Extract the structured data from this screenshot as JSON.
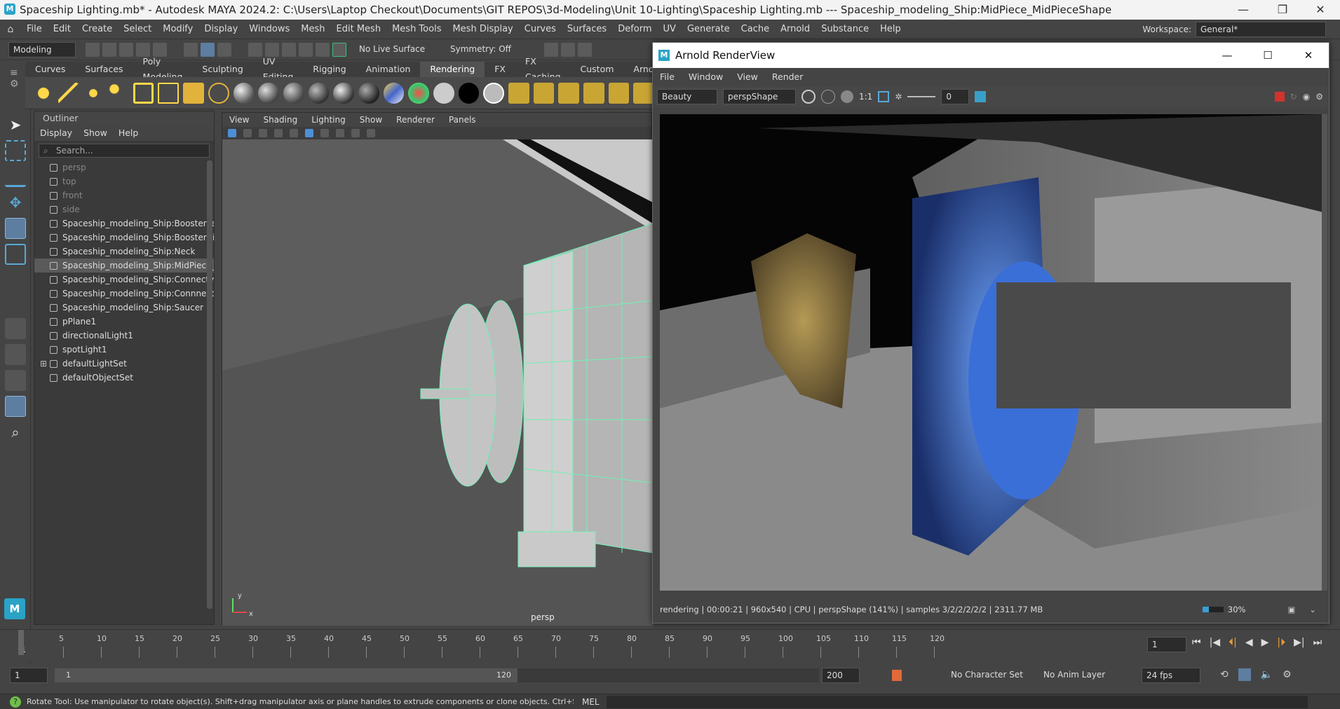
{
  "title_bar": {
    "title": "Spaceship Lighting.mb* - Autodesk MAYA 2024.2: C:\\Users\\Laptop Checkout\\Documents\\GIT REPOS\\3d-Modeling\\Unit 10-Lighting\\Spaceship Lighting.mb   ---   Spaceship_modeling_Ship:MidPiece_MidPieceShape"
  },
  "menu": [
    "File",
    "Edit",
    "Create",
    "Select",
    "Modify",
    "Display",
    "Windows",
    "Mesh",
    "Edit Mesh",
    "Mesh Tools",
    "Mesh Display",
    "Curves",
    "Surfaces",
    "Deform",
    "UV",
    "Generate",
    "Cache",
    "Arnold",
    "Substance",
    "Help"
  ],
  "workspace": {
    "label": "Workspace:",
    "value": "General*"
  },
  "status_line": {
    "mode": "Modeling",
    "live_surface": "No Live Surface",
    "symmetry": "Symmetry: Off"
  },
  "shelf_tabs": [
    "Curves",
    "Surfaces",
    "Poly Modeling",
    "Sculpting",
    "UV Editing",
    "Rigging",
    "Animation",
    "Rendering",
    "FX",
    "FX Caching",
    "Custom",
    "Arnold"
  ],
  "shelf_active": "Rendering",
  "outliner": {
    "title": "Outliner",
    "menu": [
      "Display",
      "Show",
      "Help"
    ],
    "search_placeholder": "Search...",
    "items": [
      {
        "label": "persp",
        "dim": true
      },
      {
        "label": "top",
        "dim": true
      },
      {
        "label": "front",
        "dim": true
      },
      {
        "label": "side",
        "dim": true
      },
      {
        "label": "Spaceship_modeling_Ship:BoosterLef"
      },
      {
        "label": "Spaceship_modeling_Ship:BoosterRig"
      },
      {
        "label": "Spaceship_modeling_Ship:Neck"
      },
      {
        "label": "Spaceship_modeling_Ship:MidPiece_I",
        "selected": true
      },
      {
        "label": "Spaceship_modeling_Ship:ConnectyL"
      },
      {
        "label": "Spaceship_modeling_Ship:Connnecty"
      },
      {
        "label": "Spaceship_modeling_Ship:Saucer"
      },
      {
        "label": "pPlane1"
      },
      {
        "label": "directionalLight1"
      },
      {
        "label": "spotLight1"
      },
      {
        "label": "defaultLightSet",
        "expandable": true
      },
      {
        "label": "defaultObjectSet"
      }
    ]
  },
  "viewport": {
    "menu": [
      "View",
      "Shading",
      "Lighting",
      "Show",
      "Renderer",
      "Panels"
    ],
    "camera_label": "persp",
    "axis_y": "y",
    "axis_x": "x"
  },
  "arnold": {
    "title": "Arnold RenderView",
    "menu": [
      "File",
      "Window",
      "View",
      "Render"
    ],
    "aov": "Beauty",
    "camera": "perspShape",
    "ratio": "1:1",
    "exposure": "0",
    "status": "rendering | 00:00:21 | 960x540 | CPU | perspShape (141%) | samples 3/2/2/2/2/2 | 2311.77 MB",
    "progress": "30%",
    "progress_value": 0.3
  },
  "timeline": {
    "ticks": [
      "5",
      "10",
      "15",
      "20",
      "25",
      "30",
      "35",
      "40",
      "45",
      "50",
      "55",
      "60",
      "65",
      "70",
      "75",
      "80",
      "85",
      "90",
      "95",
      "100",
      "105",
      "110",
      "115",
      "120"
    ],
    "start_label": "1",
    "current_frame": "1"
  },
  "range": {
    "start": "1",
    "inner_start": "1",
    "inner_end": "120",
    "end": "200",
    "character_set": "No Character Set",
    "anim_layer": "No Anim Layer",
    "fps": "24 fps"
  },
  "help_line": {
    "text": "Rotate Tool: Use manipulator to rotate object(s). Shift+drag manipulator axis or plane handles to extrude components or clone objects. Ctrl+Shift+LMB+drag to constrain rotatio",
    "lang": "MEL"
  }
}
